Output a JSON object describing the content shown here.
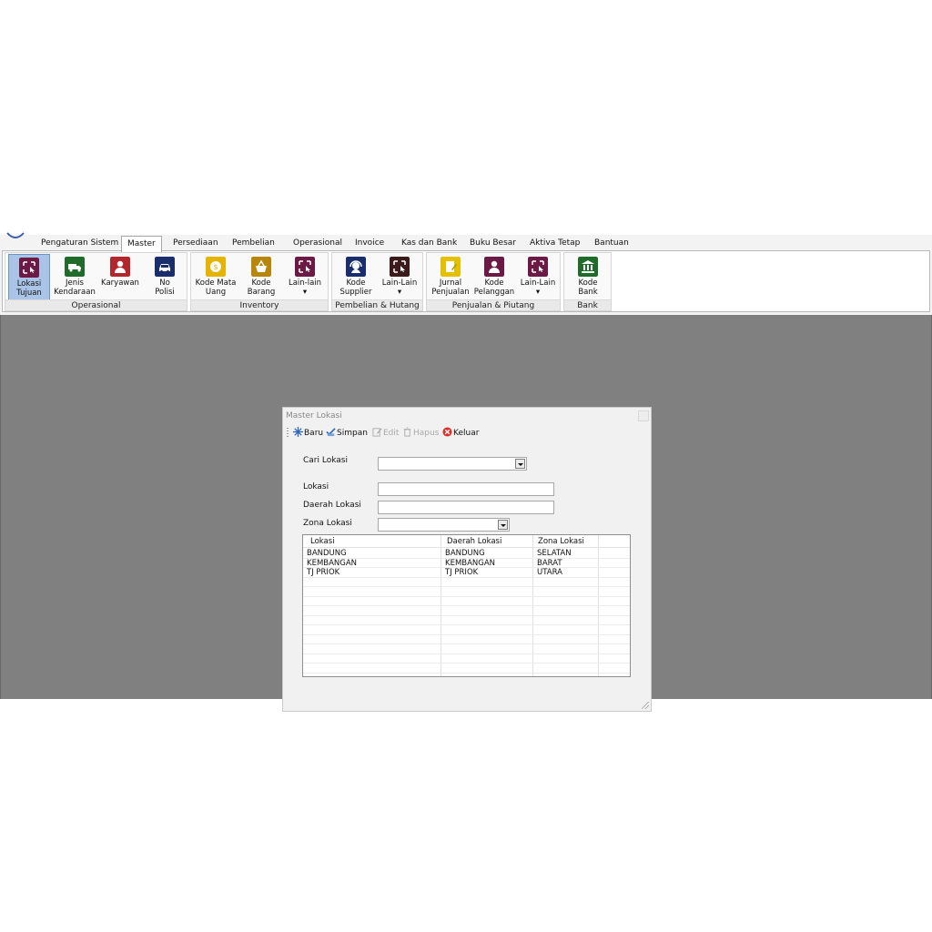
{
  "menu": {
    "tabs": [
      {
        "label": "Pengaturan Sistem"
      },
      {
        "label": "Master"
      },
      {
        "label": "Persediaan"
      },
      {
        "label": "Pembelian"
      },
      {
        "label": "Operasional"
      },
      {
        "label": "Invoice"
      },
      {
        "label": "Kas dan Bank"
      },
      {
        "label": "Buku Besar"
      },
      {
        "label": "Aktiva Tetap"
      },
      {
        "label": "Bantuan"
      }
    ],
    "active": "Master"
  },
  "ribbon": {
    "groups": [
      {
        "label": "Operasional",
        "buttons": [
          {
            "label": "Lokasi\nTujuan",
            "icon": "location-target-icon",
            "color": "#6b1a45"
          },
          {
            "label": "Jenis\nKendaraan",
            "icon": "truck-icon",
            "color": "#1f6b2a"
          },
          {
            "label": "Karyawan",
            "icon": "person-icon",
            "color": "#b3262b"
          },
          {
            "label": "No\nPolisi",
            "icon": "car-icon",
            "color": "#1a2e6e"
          }
        ]
      },
      {
        "label": "Inventory",
        "buttons": [
          {
            "label": "Kode Mata\nUang",
            "icon": "coin-icon",
            "color": "#e5b400"
          },
          {
            "label": "Kode\nBarang",
            "icon": "basket-icon",
            "color": "#b8860b"
          },
          {
            "label": "Lain-lain\n▾",
            "icon": "location-target-icon",
            "color": "#6b1a45"
          }
        ]
      },
      {
        "label": "Pembelian & Hutang",
        "buttons": [
          {
            "label": "Kode\nSupplier",
            "icon": "headset-icon",
            "color": "#1a2e6e"
          },
          {
            "label": "Lain-Lain\n▾",
            "icon": "location-target-icon",
            "color": "#3a1a1a"
          }
        ]
      },
      {
        "label": "Penjualan & Piutang",
        "buttons": [
          {
            "label": "Jurnal\nPenjualan",
            "icon": "journal-icon",
            "color": "#e5c000"
          },
          {
            "label": "Kode\nPelanggan",
            "icon": "customer-icon",
            "color": "#6b1a45"
          },
          {
            "label": "Lain-Lain\n▾",
            "icon": "location-target-icon",
            "color": "#6b1a45"
          }
        ]
      },
      {
        "label": "Bank",
        "buttons": [
          {
            "label": "Kode\nBank",
            "icon": "bank-icon",
            "color": "#1f6b2a"
          }
        ]
      }
    ]
  },
  "dialog": {
    "title": "Master Lokasi",
    "toolbar": {
      "baru": "Baru",
      "simpan": "Simpan",
      "edit": "Edit",
      "hapus": "Hapus",
      "keluar": "Keluar"
    },
    "form": {
      "cari_lokasi_label": "Cari Lokasi",
      "cari_lokasi_value": "",
      "lokasi_label": "Lokasi",
      "lokasi_value": "",
      "daerah_label": "Daerah Lokasi",
      "daerah_value": "",
      "zona_label": "Zona Lokasi",
      "zona_value": ""
    },
    "grid": {
      "columns": [
        "Lokasi",
        "Daerah Lokasi",
        "Zona Lokasi"
      ],
      "rows": [
        [
          "BANDUNG",
          "BANDUNG",
          "SELATAN"
        ],
        [
          "KEMBANGAN",
          "KEMBANGAN",
          "BARAT"
        ],
        [
          "TJ PRIOK",
          "TJ PRIOK",
          "UTARA"
        ]
      ]
    }
  }
}
